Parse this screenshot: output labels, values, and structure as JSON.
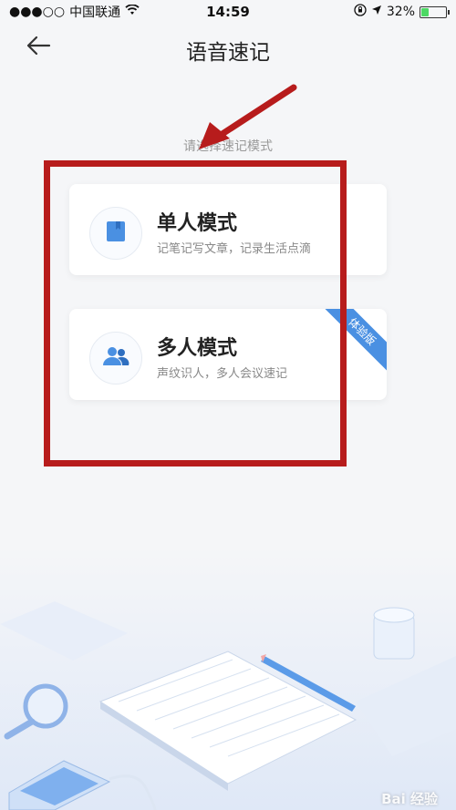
{
  "status_bar": {
    "signal": "●●●○○",
    "carrier": "中国联通",
    "time": "14:59",
    "battery_percent": "32%",
    "battery_level": 0.32
  },
  "nav": {
    "title": "语音速记",
    "back_icon": "back-arrow-icon"
  },
  "hint": "请选择速记模式",
  "modes": [
    {
      "title": "单人模式",
      "desc": "记笔记写文章，记录生活点滴",
      "icon": "bookmark-icon"
    },
    {
      "title": "多人模式",
      "desc": "声纹识人，多人会议速记",
      "icon": "users-icon",
      "badge": "体验版"
    }
  ],
  "watermark": "Bai 经验",
  "colors": {
    "accent": "#4a90e2",
    "annotation": "#b71c1c"
  }
}
